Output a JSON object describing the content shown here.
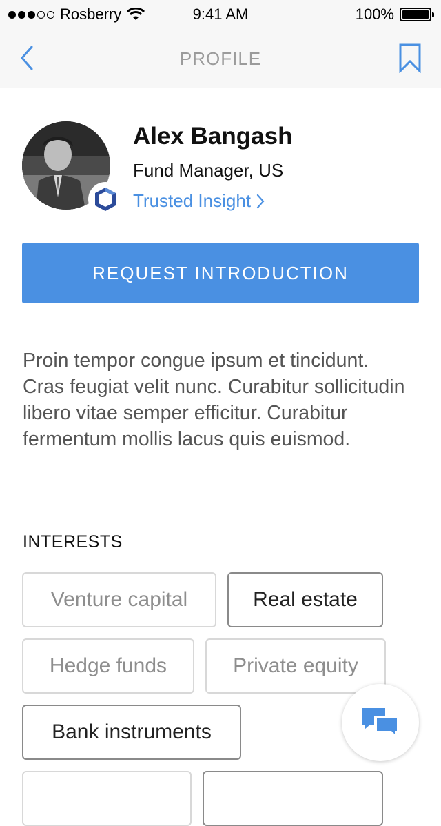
{
  "status_bar": {
    "carrier": "Rosberry",
    "time": "9:41 AM",
    "battery": "100%"
  },
  "nav": {
    "title": "PROFILE"
  },
  "profile": {
    "name": "Alex Bangash",
    "role": "Fund Manager, US",
    "trusted_label": "Trusted Insight"
  },
  "actions": {
    "request_introduction": "REQUEST INTRODUCTION"
  },
  "bio": "Proin tempor congue ipsum et tincidunt. Cras feugiat velit nunc. Curabitur sollicitudin libero vitae semper efficitur. Curabitur fermentum mollis lacus quis euismod.",
  "interests": {
    "title": "INTERESTS",
    "items": [
      {
        "label": "Venture capital",
        "selected": false
      },
      {
        "label": "Real estate",
        "selected": true
      },
      {
        "label": "Hedge funds",
        "selected": false
      },
      {
        "label": "Private equity",
        "selected": false
      },
      {
        "label": "Bank instruments",
        "selected": true
      },
      {
        "label": "",
        "selected": false
      },
      {
        "label": "",
        "selected": true
      }
    ]
  },
  "icons": {
    "back": "chevron-left-icon",
    "bookmark": "bookmark-icon",
    "trusted_badge": "trusted-insight-logo-icon",
    "chat": "chat-bubbles-icon",
    "wifi": "wifi-icon",
    "battery": "battery-icon"
  },
  "colors": {
    "accent": "#4a90e2",
    "nav_bg": "#f7f7f7",
    "muted_text": "#9b9b9b"
  }
}
